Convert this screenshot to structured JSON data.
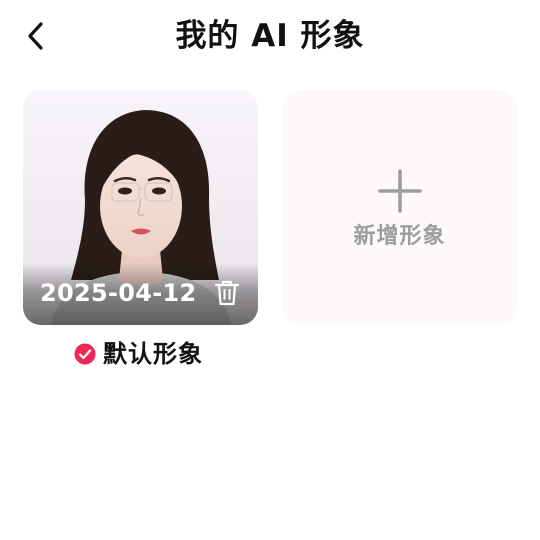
{
  "header": {
    "title": "我的 AI 形象",
    "back_icon": "chevron-left-icon"
  },
  "avatars": [
    {
      "date": "2025-04-12",
      "is_default": true,
      "default_label": "默认形象",
      "delete_icon": "trash-icon"
    }
  ],
  "add_card": {
    "label": "新增形象",
    "icon": "plus-icon"
  },
  "colors": {
    "accent": "#f0285a",
    "title_text": "#111111",
    "muted_text": "#9d9d9d",
    "add_card_bg": "#fcf8fc"
  }
}
